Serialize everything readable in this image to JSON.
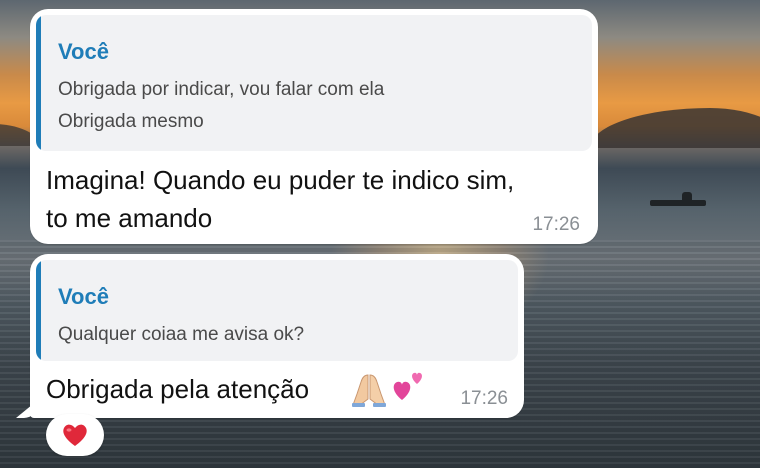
{
  "chat": {
    "messages": [
      {
        "reply_to": {
          "sender": "Você",
          "lines": [
            "Obrigada por indicar, vou falar com ela",
            "Obrigada mesmo"
          ]
        },
        "lines": [
          "Imagina! Quando eu puder te indico sim,",
          "to me amando"
        ],
        "time": "17:26"
      },
      {
        "reply_to": {
          "sender": "Você",
          "lines": [
            "Qualquer coiaa me avisa ok?"
          ]
        },
        "lines": [
          "Obrigada pela atenção"
        ],
        "emojis": [
          "folded-hands",
          "two-hearts"
        ],
        "time": "17:26",
        "reaction": "red-heart"
      }
    ]
  },
  "colors": {
    "quote_accent": "#1f7db8",
    "bubble": "#ffffff",
    "quote_bg": "#f1f2f4",
    "time_text": "#8a8f94",
    "reaction_heart": "#e0283a"
  }
}
